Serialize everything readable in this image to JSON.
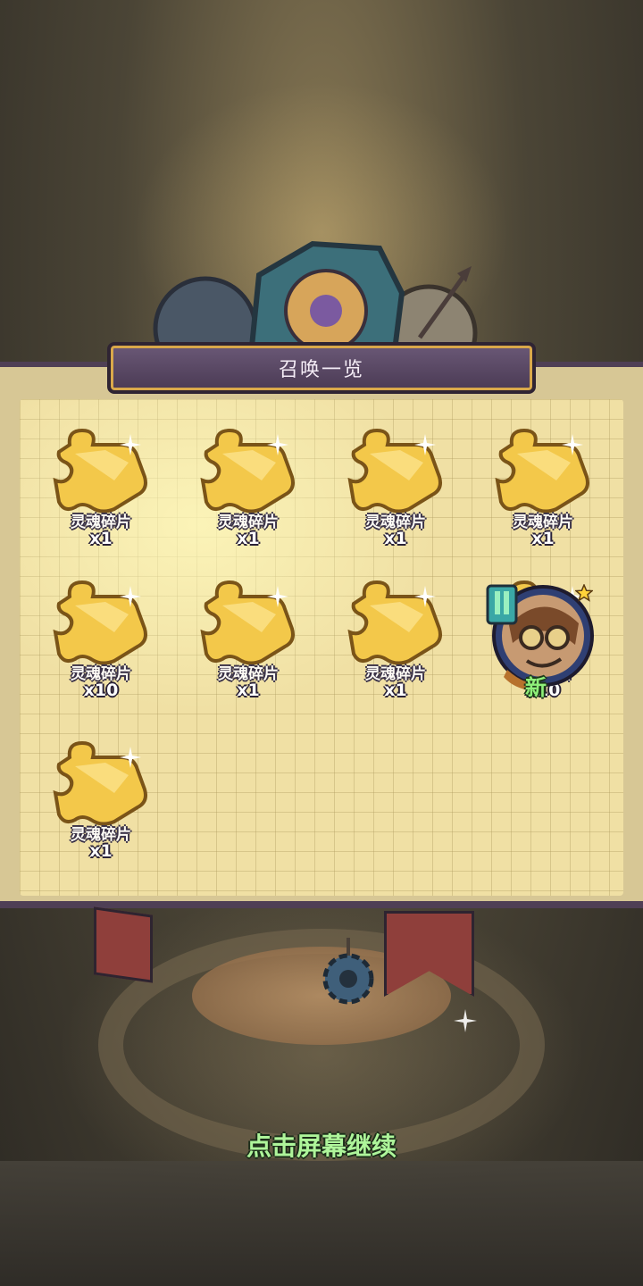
{
  "title": "召唤一览",
  "items": [
    {
      "label": "灵魂碎片",
      "qty": "x1"
    },
    {
      "label": "灵魂碎片",
      "qty": "x1"
    },
    {
      "label": "灵魂碎片",
      "qty": "x1"
    },
    {
      "label": "灵魂碎片",
      "qty": "x1"
    },
    {
      "label": "灵魂碎片",
      "qty": "x10"
    },
    {
      "label": "灵魂碎片",
      "qty": "x1"
    },
    {
      "label": "灵魂碎片",
      "qty": "x1"
    },
    {
      "label": "灵魂碎片",
      "qty": "x10"
    },
    {
      "label": "灵魂碎片",
      "qty": "x1"
    }
  ],
  "hero": {
    "badge": "新",
    "stars": 1
  },
  "continue_hint": "点击屏幕继续",
  "colors": {
    "piece": "#f3c84a",
    "label_outline": "#3a3248",
    "hint": "#aef59a",
    "new_badge": "#8ff07a"
  },
  "icons": [
    "soul-fragment-icon",
    "hero-portrait-icon",
    "star-icon",
    "gear-icon",
    "sparkle-icon"
  ]
}
